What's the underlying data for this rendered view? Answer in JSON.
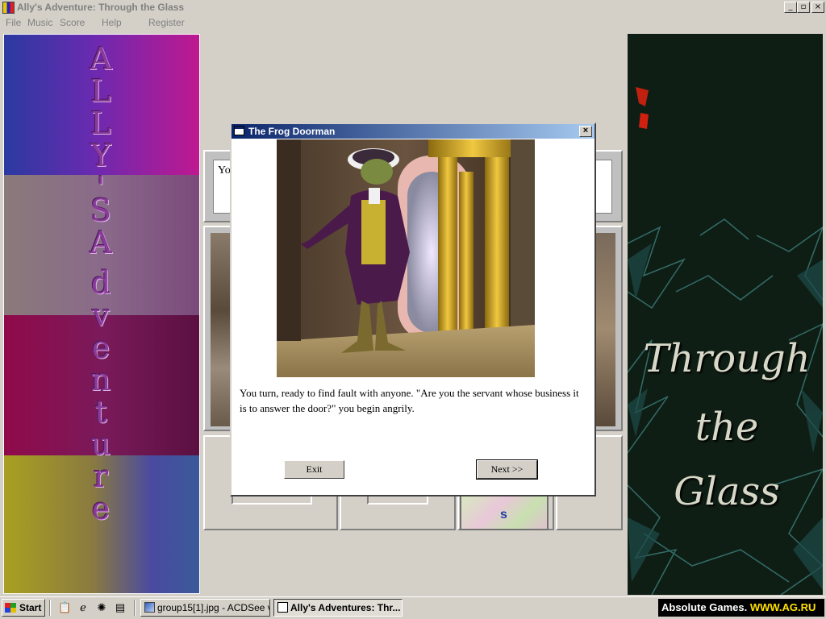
{
  "window": {
    "title": "Ally's Adventure: Through the Glass",
    "min_label": "_",
    "max_label": "▫",
    "close_label": "×"
  },
  "menu": [
    "File",
    "Music",
    "Score",
    "Help",
    "Register"
  ],
  "left_panel": {
    "title_letters": [
      "A",
      "L",
      "L",
      "Y",
      "'",
      "S",
      "A",
      "d",
      "v",
      "e",
      "n",
      "t",
      "u",
      "r",
      "e"
    ],
    "band_colors": [
      "#7a3ab0",
      "#8a6a8a",
      "#7a1a4a",
      "#8a8a30"
    ]
  },
  "text_area": {
    "visible_text": "Yo"
  },
  "inventory": {
    "thumb_letter": "s"
  },
  "right_panel": {
    "title_lines": [
      "Through",
      "the",
      "Glass"
    ],
    "bg_color": "#0f1e14"
  },
  "dialog": {
    "title": "The Frog Doorman",
    "close_label": "×",
    "text": "You turn, ready to find fault with anyone.  \"Are you the servant whose business it is to answer the door?\" you begin angrily.",
    "exit_label": "Exit",
    "next_label": "Next >>"
  },
  "taskbar": {
    "start_label": "Start",
    "quick_launch_icons": [
      "desktop-icon",
      "internet-icon",
      "channel-icon",
      "media-icon"
    ],
    "tasks": [
      {
        "label": "group15[1].jpg - ACDSee v...",
        "active": false
      },
      {
        "label": "Ally's Adventures: Thr...",
        "active": true
      }
    ],
    "tray_prefix": "Absolute Games.",
    "tray_site": "WWW.AG.RU"
  }
}
